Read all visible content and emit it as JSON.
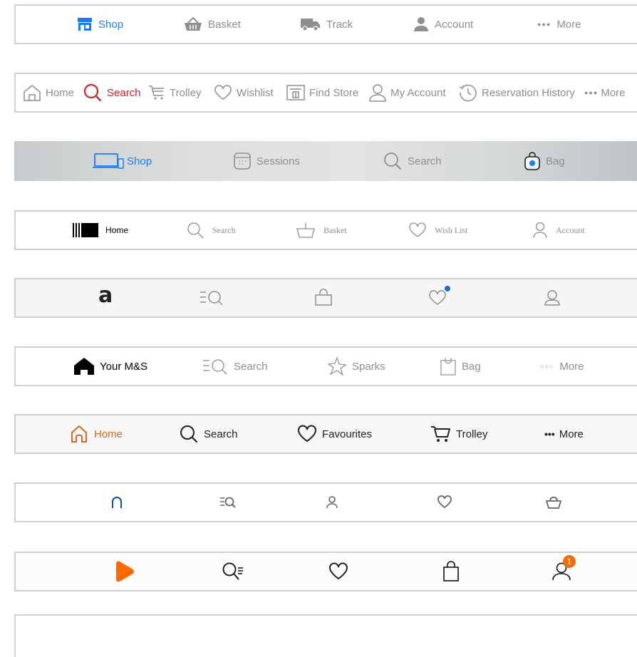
{
  "colors": {
    "apple_blue": "#1d7cf2",
    "grey": "#8e8e93",
    "argos_red": "#c1272d",
    "orange": "#d46a1f",
    "zalando_orange": "#ff6900",
    "blue_dark": "#0b4ea2"
  },
  "bars": [
    {
      "items": [
        {
          "label": "Shop",
          "icon": "store-icon"
        },
        {
          "label": "Basket",
          "icon": "basket-icon"
        },
        {
          "label": "Track",
          "icon": "truck-icon"
        },
        {
          "label": "Account",
          "icon": "person-icon"
        },
        {
          "label": "More",
          "icon": "more-dots-icon",
          "glyph": "●●●"
        }
      ]
    },
    {
      "items": [
        {
          "label": "Home",
          "icon": "home-icon"
        },
        {
          "label": "Search",
          "icon": "search-icon"
        },
        {
          "label": "Trolley",
          "icon": "trolley-icon"
        },
        {
          "label": "Wishlist",
          "icon": "heart-icon"
        },
        {
          "label": "Find Store",
          "icon": "store-icon"
        },
        {
          "label": "My Account",
          "icon": "person-icon"
        },
        {
          "label": "Reservation History",
          "icon": "clock-icon"
        },
        {
          "label": "More",
          "icon": "more-dots-icon",
          "glyph": "●●●"
        }
      ]
    },
    {
      "items": [
        {
          "label": "Shop",
          "icon": "devices-icon"
        },
        {
          "label": "Sessions",
          "icon": "calendar-icon"
        },
        {
          "label": "Search",
          "icon": "search-icon"
        },
        {
          "label": "Bag",
          "icon": "bag-icon"
        }
      ]
    },
    {
      "items": [
        {
          "label": "Home",
          "icon": "barcode-logo-icon"
        },
        {
          "label": "Search",
          "icon": "search-icon"
        },
        {
          "label": "Basket",
          "icon": "basket-icon"
        },
        {
          "label": "Wish List",
          "icon": "heart-icon"
        },
        {
          "label": "Account",
          "icon": "person-icon"
        }
      ]
    },
    {
      "items": [
        {
          "icon": "asos-logo-icon",
          "glyph": "a"
        },
        {
          "icon": "search-list-icon"
        },
        {
          "icon": "bag-icon"
        },
        {
          "icon": "heart-icon"
        },
        {
          "icon": "person-icon"
        }
      ]
    },
    {
      "items": [
        {
          "label": "Your M&S",
          "icon": "home-icon"
        },
        {
          "label": "Search",
          "icon": "search-list-icon"
        },
        {
          "label": "Sparks",
          "icon": "sparks-star-icon"
        },
        {
          "label": "Bag",
          "icon": "bag-icon"
        },
        {
          "label": "More",
          "icon": "more-dots-icon",
          "glyph": "○○○"
        }
      ]
    },
    {
      "items": [
        {
          "label": "Home",
          "icon": "home-icon"
        },
        {
          "label": "Search",
          "icon": "search-icon"
        },
        {
          "label": "Favourites",
          "icon": "heart-icon"
        },
        {
          "label": "Trolley",
          "icon": "trolley-icon"
        },
        {
          "label": "More",
          "icon": "more-dots-icon",
          "glyph": "•••"
        }
      ]
    },
    {
      "items": [
        {
          "icon": "home-arch-icon"
        },
        {
          "icon": "search-list-icon"
        },
        {
          "icon": "person-icon"
        },
        {
          "icon": "heart-icon"
        },
        {
          "icon": "basket-icon"
        }
      ]
    },
    {
      "items": [
        {
          "icon": "zalando-logo-icon"
        },
        {
          "icon": "search-list-icon"
        },
        {
          "icon": "heart-icon"
        },
        {
          "icon": "bag-icon"
        },
        {
          "icon": "person-icon",
          "badge": "1"
        }
      ]
    },
    {
      "items": []
    }
  ]
}
